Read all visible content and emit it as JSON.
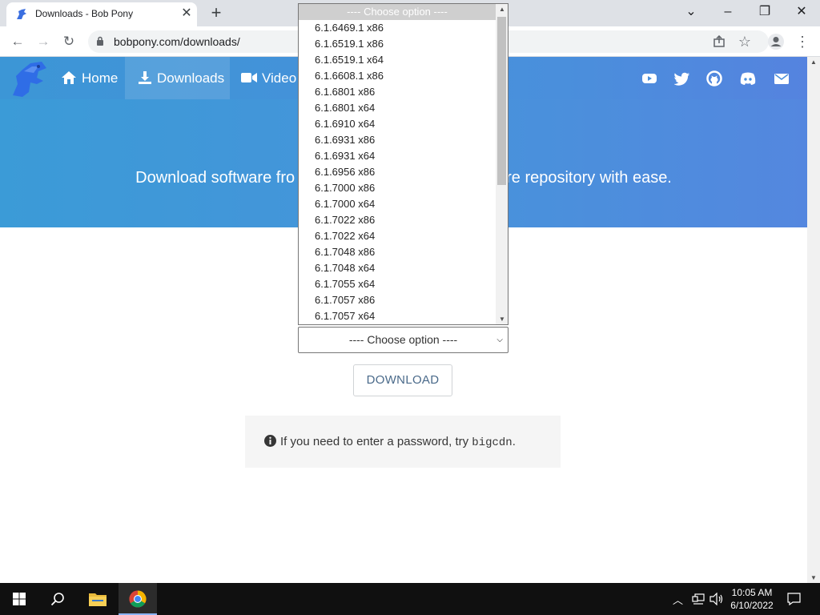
{
  "browser": {
    "tab_title": "Downloads - Bob Pony",
    "url": "bobpony.com/downloads/"
  },
  "site": {
    "nav": {
      "home": "Home",
      "downloads": "Downloads",
      "video": "Video"
    },
    "tagline_left": "Download software fro",
    "tagline_right": "re repository with ease."
  },
  "select": {
    "current_value": "---- Choose option ----",
    "options": [
      "---- Choose option ----",
      "6.1.6469.1 x86",
      "6.1.6519.1 x86",
      "6.1.6519.1 x64",
      "6.1.6608.1 x86",
      "6.1.6801 x86",
      "6.1.6801 x64",
      "6.1.6910 x64",
      "6.1.6931 x86",
      "6.1.6931 x64",
      "6.1.6956 x86",
      "6.1.7000 x86",
      "6.1.7000 x64",
      "6.1.7022 x86",
      "6.1.7022 x64",
      "6.1.7048 x86",
      "6.1.7048 x64",
      "6.1.7055 x64",
      "6.1.7057 x86",
      "6.1.7057 x64"
    ]
  },
  "download_button": "DOWNLOAD",
  "notice": {
    "text": "If you need to enter a password, try ",
    "code": "bigcdn",
    "end": "."
  },
  "taskbar": {
    "time": "10:05 AM",
    "date": "6/10/2022"
  },
  "colors": {
    "hero_start": "#3b9bd7",
    "hero_end": "#5487df",
    "taskbar": "#101010"
  }
}
